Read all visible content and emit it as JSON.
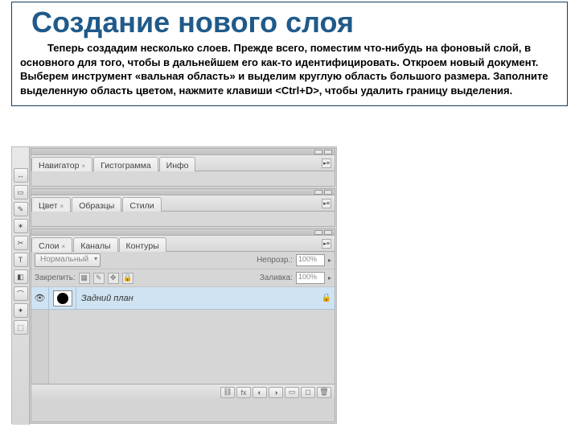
{
  "header": {
    "title": "Создание нового слоя",
    "description": "Теперь создадим несколько слоев. Прежде всего, поместим что-нибудь на фоновый слой, в основного для того, чтобы в дальнейшем его как-то идентифицировать. Откроем новый документ. Выберем инструмент «вальная область» и выделим круглую область большого размера. Заполните выделенную область цветом, нажмите клавиши <Ctrl+D>, чтобы удалить границу выделения."
  },
  "panels": {
    "navigator": {
      "tabs": [
        "Навигатор",
        "Гистограмма",
        "Инфо"
      ],
      "active": 0
    },
    "color": {
      "tabs": [
        "Цвет",
        "Образцы",
        "Стили"
      ],
      "active": 0
    },
    "layers": {
      "tabs": [
        "Слои",
        "Каналы",
        "Контуры"
      ],
      "active": 0,
      "blend_mode": "Нормальный",
      "opacity_label": "Непрозр.:",
      "opacity_value": "100%",
      "lock_label": "Закрепить:",
      "fill_label": "Заливка:",
      "fill_value": "100%",
      "items": [
        {
          "name": "Задний план",
          "locked": true,
          "has_circle": true
        }
      ]
    }
  },
  "toolbar_icons": [
    "move",
    "marquee",
    "lasso",
    "wand",
    "crop",
    "eyedrop",
    "brush",
    "stamp",
    "eraser",
    "grad",
    "blur",
    "pen",
    "type",
    "path",
    "shape"
  ]
}
